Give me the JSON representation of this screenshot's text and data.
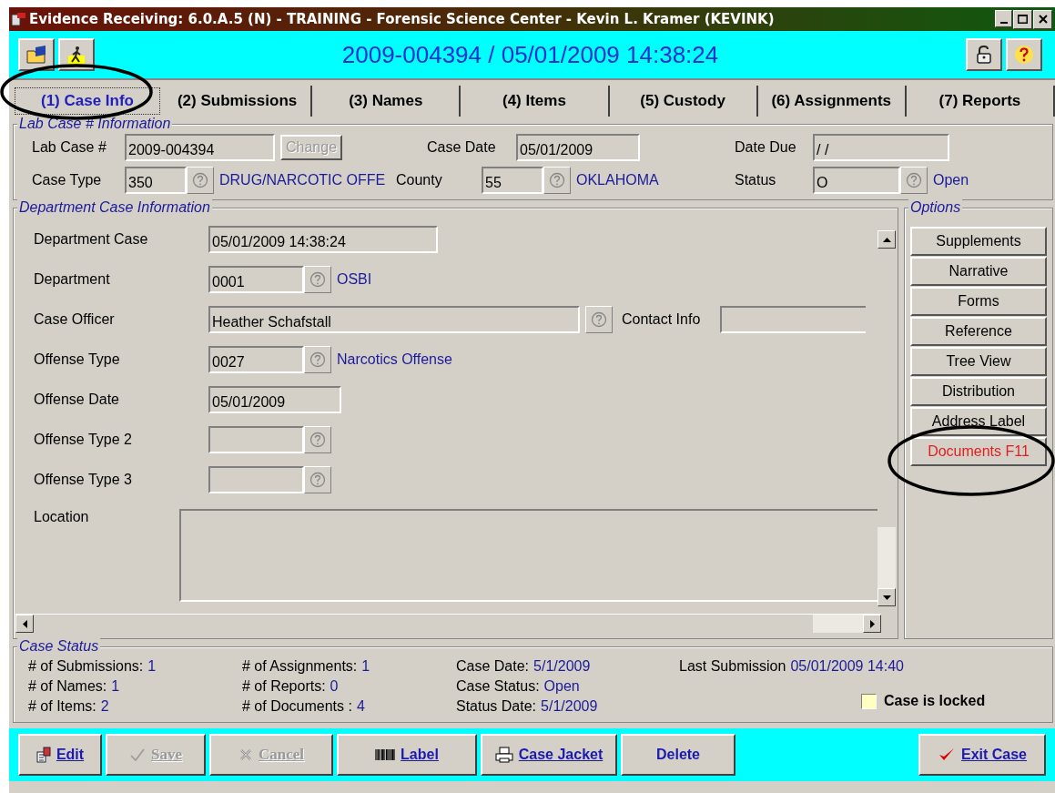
{
  "window": {
    "title": "Evidence Receiving: 6.0.A.5 (N) - TRAINING - Forensic Science Center - Kevin L. Kramer (KEVINK)"
  },
  "header": {
    "case_id": "2009-004394 / 05/01/2009 14:38:24"
  },
  "tabs": [
    {
      "label": "(1) Case Info",
      "selected": true
    },
    {
      "label": "(2) Submissions",
      "selected": false
    },
    {
      "label": "(3) Names",
      "selected": false
    },
    {
      "label": "(4) Items",
      "selected": false
    },
    {
      "label": "(5) Custody",
      "selected": false
    },
    {
      "label": "(6) Assignments",
      "selected": false
    },
    {
      "label": "(7) Reports",
      "selected": false
    }
  ],
  "lab_case": {
    "title": "Lab Case # Information",
    "lab_case_no": {
      "label": "Lab Case #",
      "value": "2009-004394",
      "button": "Change",
      "button_disabled": true
    },
    "case_date": {
      "label": "Case Date",
      "value": "05/01/2009"
    },
    "date_due": {
      "label": "Date Due",
      "value": " /  /"
    },
    "case_type": {
      "label": "Case Type",
      "value": "350",
      "description": "DRUG/NARCOTIC OFFE"
    },
    "county": {
      "label": "County",
      "value": "55",
      "description": "OKLAHOMA"
    },
    "status": {
      "label": "Status",
      "value": "O",
      "description": "Open"
    }
  },
  "department": {
    "title": "Department Case Information",
    "rows": [
      {
        "kind": "text",
        "label": "Department Case",
        "value": "05/01/2009 14:38:24"
      },
      {
        "kind": "lookup",
        "label": "Department",
        "value": "0001",
        "description": "OSBI"
      },
      {
        "kind": "officer",
        "label": "Case Officer",
        "value": "Heather Schafstall",
        "contact_label": "Contact Info",
        "contact_value": ""
      },
      {
        "kind": "lookup",
        "label": "Offense Type",
        "value": "0027",
        "description": "Narcotics Offense"
      },
      {
        "kind": "date",
        "label": "Offense Date",
        "value": "05/01/2009"
      },
      {
        "kind": "lookup",
        "label": "Offense Type 2",
        "value": ""
      },
      {
        "kind": "lookup",
        "label": "Offense Type 3",
        "value": ""
      },
      {
        "kind": "memo",
        "label": "Location",
        "value": ""
      }
    ]
  },
  "options": {
    "title": "Options",
    "buttons": [
      {
        "label": "Supplements",
        "alert": false
      },
      {
        "label": "Narrative",
        "alert": false
      },
      {
        "label": "Forms",
        "alert": false
      },
      {
        "label": "Reference",
        "alert": false
      },
      {
        "label": "Tree View",
        "alert": false
      },
      {
        "label": "Distribution",
        "alert": false
      },
      {
        "label": "Address Label",
        "alert": false
      },
      {
        "label": "Documents F11",
        "alert": true
      }
    ]
  },
  "case_status": {
    "title": "Case Status",
    "columns": [
      [
        {
          "label": "# of Submissions:",
          "value": "1"
        },
        {
          "label": "# of Names:",
          "value": "1"
        },
        {
          "label": "# of Items:",
          "value": "2"
        }
      ],
      [
        {
          "label": "# of Assignments:",
          "value": "1"
        },
        {
          "label": "# of Reports:",
          "value": "0"
        },
        {
          "label": "# of Documents :",
          "value": "4"
        }
      ],
      [
        {
          "label": "Case Date:",
          "value": "5/1/2009"
        },
        {
          "label": "Case Status:",
          "value": "Open"
        },
        {
          "label": "Status Date:",
          "value": "5/1/2009"
        }
      ]
    ],
    "last_submission": {
      "label": "Last Submission",
      "value": "05/01/2009 14:40"
    },
    "locked": {
      "label": "Case is locked",
      "checked": false
    }
  },
  "actions": [
    {
      "kind": "edit",
      "label": "Edit",
      "disabled": false
    },
    {
      "kind": "save",
      "label": "Save",
      "disabled": true
    },
    {
      "kind": "cancel",
      "label": "Cancel",
      "disabled": true
    },
    {
      "kind": "label",
      "label": "Label",
      "disabled": false
    },
    {
      "kind": "jacket",
      "label": "Case Jacket",
      "disabled": false
    },
    {
      "kind": "delete",
      "label": "Delete",
      "disabled": false
    },
    {
      "kind": "exit",
      "label": "Exit Case",
      "disabled": false
    }
  ]
}
